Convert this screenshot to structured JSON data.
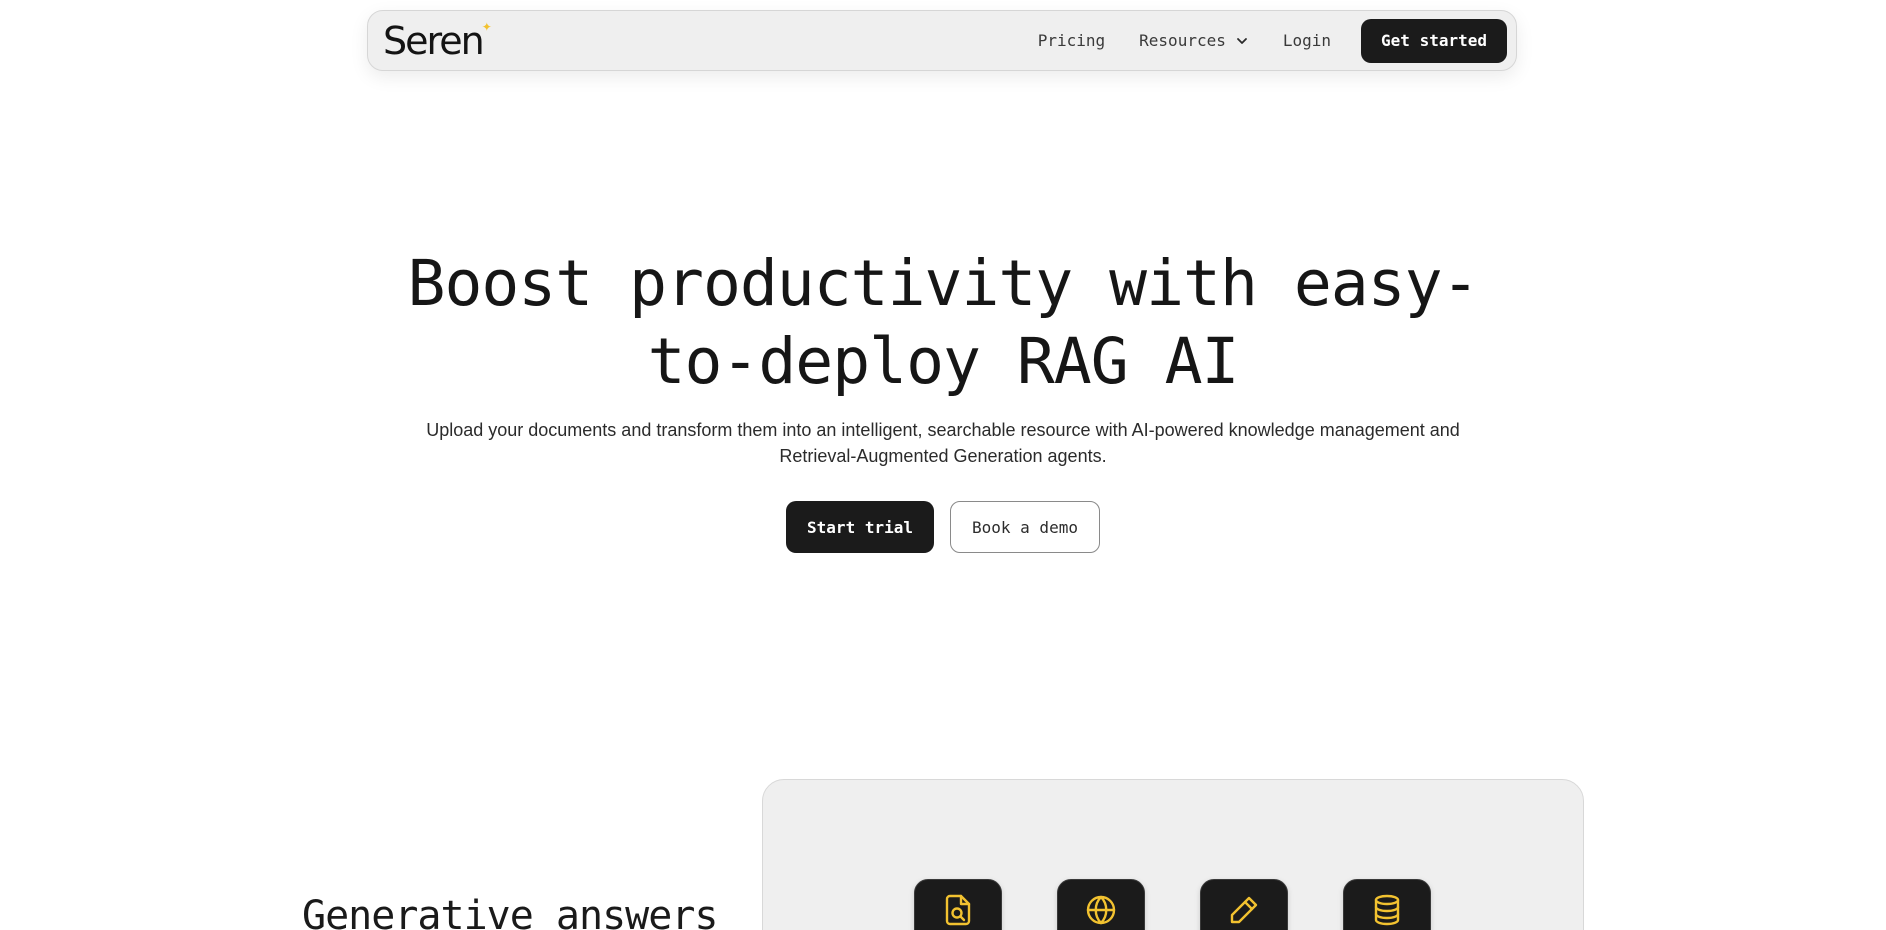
{
  "colors": {
    "accent": "#f2c230",
    "dark": "#1b1b1b",
    "panel": "#efefef"
  },
  "nav": {
    "logo_text": "Seren",
    "links": [
      {
        "label": "Pricing"
      },
      {
        "label": "Resources",
        "icon": "chevron-down-icon"
      },
      {
        "label": "Login"
      }
    ],
    "cta_label": "Get started"
  },
  "hero": {
    "title_line1": "Boost productivity with easy-",
    "title_line2": "to-deploy RAG AI",
    "subtitle_line1": "Upload your documents and transform them into an intelligent, searchable resource with AI-powered knowledge management and",
    "subtitle_line2": "Retrieval-Augmented Generation agents.",
    "primary_cta": "Start trial",
    "secondary_cta": "Book a demo"
  },
  "features": {
    "heading": "Generative answers",
    "icons": [
      "document-search-icon",
      "globe-icon",
      "pencil-icon",
      "database-icon"
    ]
  }
}
